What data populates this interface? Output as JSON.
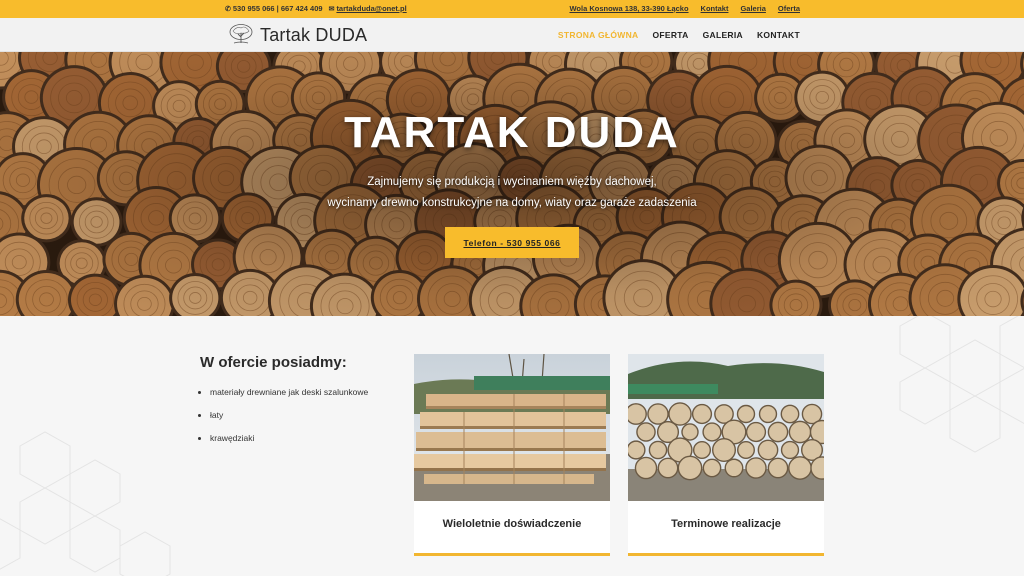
{
  "topbar": {
    "phones": "530 955 066 | 667 424 409",
    "email": "tartakduda@onet.pl",
    "links": [
      "Wola Kosnowa 138, 33-390 Łącko",
      "Kontakt",
      "Galeria",
      "Oferta"
    ]
  },
  "header": {
    "logo_text": "Tartak DUDA",
    "nav": [
      "STRONA GŁÓWNA",
      "OFERTA",
      "GALERIA",
      "KONTAKT"
    ]
  },
  "hero": {
    "title": "TARTAK DUDA",
    "subtitle_line1": "Zajmujemy się produkcją i wycinaniem więźby dachowej,",
    "subtitle_line2": "wycinamy drewno konstrukcyjne na domy, wiaty oraz garaże zadaszenia",
    "button": "Telefon - 530 955 066"
  },
  "offer": {
    "heading": "W ofercie posiadmy:",
    "items": [
      "materiały drewniane jak deski szalunkowe",
      "łaty",
      "krawędziaki"
    ]
  },
  "cards": [
    {
      "title": "Wieloletnie doświadczenie",
      "image": "stacked-lumber-photo"
    },
    {
      "title": "Terminowe realizacje",
      "image": "log-pile-photo"
    }
  ],
  "colors": {
    "accent": "#f8bc2c",
    "active_nav": "#f2b630",
    "text": "#2a2a2a"
  }
}
